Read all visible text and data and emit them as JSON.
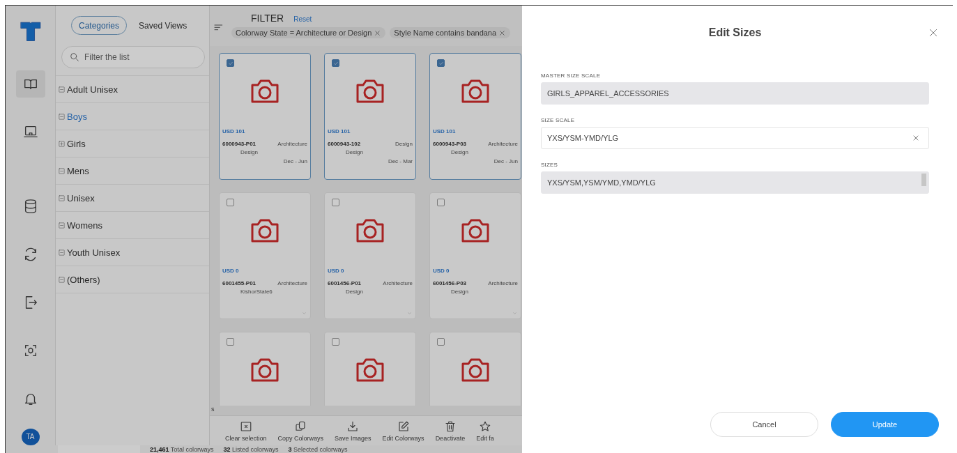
{
  "nav_rail": {
    "items": [
      {
        "selected": true
      },
      {
        "selected": false
      },
      {
        "selected": false
      },
      {
        "selected": false
      },
      {
        "selected": false
      },
      {
        "selected": false
      },
      {
        "selected": false
      }
    ],
    "avatar": "TA"
  },
  "categories": {
    "tabs": [
      {
        "label": "Categories",
        "selected": true
      },
      {
        "label": "Saved Views",
        "selected": false
      }
    ],
    "search": {
      "placeholder": "Filter the list"
    },
    "tree": [
      {
        "label": "Adult Unisex",
        "expanded": true,
        "selected": false
      },
      {
        "label": "Boys",
        "expanded": true,
        "selected": true
      },
      {
        "label": "Girls",
        "expanded": false,
        "selected": false
      },
      {
        "label": "Mens",
        "expanded": true,
        "selected": false
      },
      {
        "label": "Unisex",
        "expanded": true,
        "selected": false
      },
      {
        "label": "Womens",
        "expanded": true,
        "selected": false
      },
      {
        "label": "Youth Unisex",
        "expanded": true,
        "selected": false
      },
      {
        "label": "(Others)",
        "expanded": true,
        "selected": false
      }
    ]
  },
  "filter": {
    "title": "FILTER",
    "reset": "Reset",
    "chips": [
      {
        "label": "Colorway State = Architecture or Design"
      },
      {
        "label": "Style Name contains bandana"
      }
    ]
  },
  "colorways": [
    {
      "checked": true,
      "price": "USD 101",
      "code": "6000943-P01",
      "state": "Architecture",
      "detail": "Design",
      "dates": "Dec - Jun"
    },
    {
      "checked": true,
      "price": "USD 101",
      "code": "6000943-102",
      "state": "Design",
      "detail": "Design",
      "dates": "Dec - Mar"
    },
    {
      "checked": true,
      "price": "USD 101",
      "code": "6000943-P03",
      "state": "Architecture",
      "detail": "Design",
      "dates": "Dec - Jun"
    },
    {
      "checked": false,
      "price": "USD 0",
      "code": "6001455-P01",
      "state": "Architecture",
      "detail": "KishorState6"
    },
    {
      "checked": false,
      "price": "USD 0",
      "code": "6001456-P01",
      "state": "Architecture",
      "detail": "Design"
    },
    {
      "checked": false,
      "price": "USD 0",
      "code": "6001456-P03",
      "state": "Architecture",
      "detail": "Design"
    },
    {
      "checked": false
    },
    {
      "checked": false
    },
    {
      "checked": false
    }
  ],
  "stray_text": "s",
  "actions": [
    {
      "label": "Clear selection"
    },
    {
      "label": "Copy Colorways"
    },
    {
      "label": "Save Images"
    },
    {
      "label": "Edit Colorways"
    },
    {
      "label": "Deactivate"
    },
    {
      "label": "Edit fa"
    }
  ],
  "status_bar": {
    "counts": [
      "**21,461** Total colorways",
      "**32** Listed colorways",
      "**3** Selected colorways"
    ]
  },
  "drawer": {
    "title": "Edit Sizes",
    "fields": [
      {
        "label": "MASTER SIZE SCALE",
        "value": "GIRLS_APPAREL_ACCESSORIES",
        "disabled": true,
        "clearable": false
      },
      {
        "label": "SIZE SCALE",
        "value": "YXS/YSM-YMD/YLG",
        "disabled": false,
        "clearable": true
      },
      {
        "label": "SIZES",
        "value": "YXS/YSM,YSM/YMD,YMD/YLG",
        "disabled": true,
        "clearable": false
      }
    ],
    "buttons": [
      {
        "label": "Cancel",
        "kind": "secondary"
      },
      {
        "label": "Update",
        "kind": "primary"
      }
    ]
  }
}
